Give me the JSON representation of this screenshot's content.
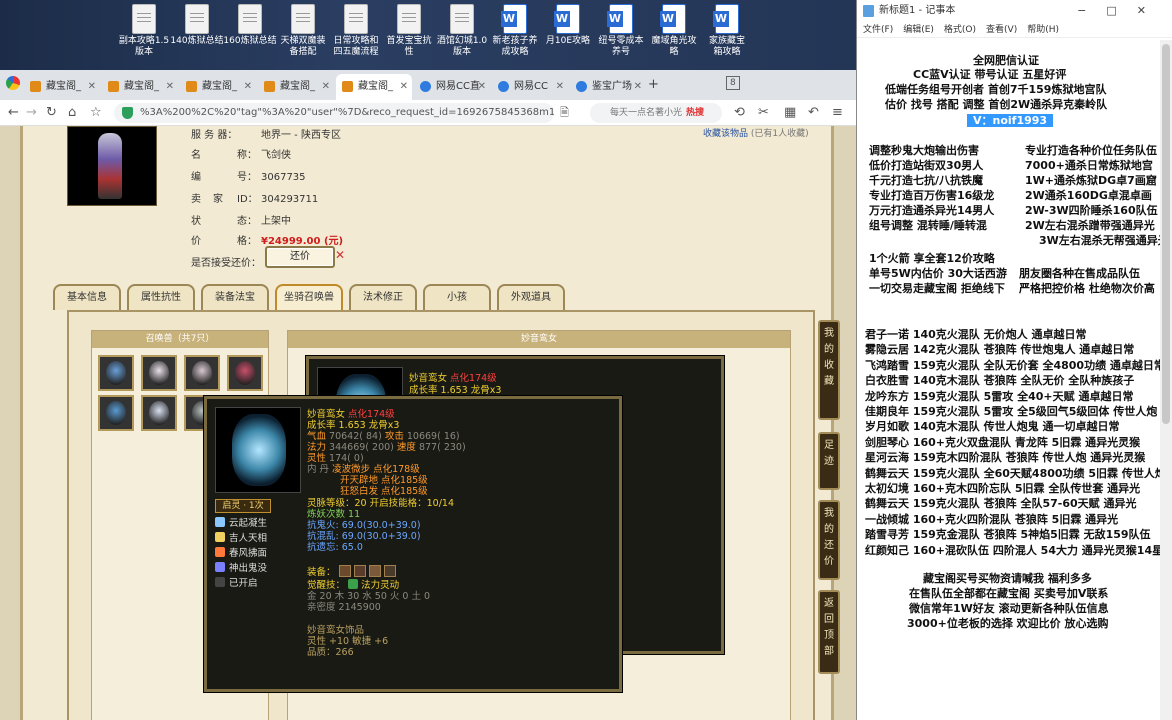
{
  "desktop": {
    "icons": [
      {
        "label": "副本攻略1.5\n版本",
        "type": "doc"
      },
      {
        "label": "140炼狱总结",
        "type": "doc"
      },
      {
        "label": "160炼狱总结",
        "type": "doc"
      },
      {
        "label": "天梯双魔装\n备搭配",
        "type": "doc"
      },
      {
        "label": "日常攻略和\n四五魔流程",
        "type": "doc"
      },
      {
        "label": "首发宝宝抗\n性",
        "type": "doc"
      },
      {
        "label": "酒馆幻城1.0\n版本",
        "type": "doc"
      },
      {
        "label": "新老孩子养\n成攻略",
        "type": "word"
      },
      {
        "label": "月10E攻略",
        "type": "word"
      },
      {
        "label": "纽号零成本\n养号",
        "type": "word"
      },
      {
        "label": "魔域角光攻\n略",
        "type": "word"
      },
      {
        "label": "家族藏宝\n箱攻略",
        "type": "word"
      }
    ]
  },
  "browser": {
    "tabs": [
      {
        "label": "藏宝阁_",
        "active": false,
        "icon": "cbg"
      },
      {
        "label": "藏宝阁_",
        "active": false,
        "icon": "cbg"
      },
      {
        "label": "藏宝阁_",
        "active": false,
        "icon": "cbg"
      },
      {
        "label": "藏宝阁_",
        "active": false,
        "icon": "cbg"
      },
      {
        "label": "藏宝阁_",
        "active": true,
        "icon": "cbg"
      },
      {
        "label": "网易CC直",
        "active": false,
        "icon": "cc"
      },
      {
        "label": "网易CC",
        "active": false,
        "icon": "cc"
      },
      {
        "label": "鉴宝广场",
        "active": false,
        "icon": "web"
      }
    ],
    "tab_count": "8",
    "url": "%3A%200%2C%20\"tag\"%3A%20\"user\"%7D&reco_request_id=1692675845368m12Ga",
    "search_placeholder": "每天一点名著小光",
    "search_badge": "热搜"
  },
  "listing": {
    "server_label": "服 务 器：",
    "server_value": "地界一 - 陕西专区",
    "name_label": "名",
    "name_label2": "称：",
    "name_value": "飞剑侠",
    "id_label": "编",
    "id_label2": "号：",
    "id_value": "3067735",
    "seller_label": "卖",
    "seller_label2": "家",
    "seller_label3": "ID：",
    "seller_value": "304293711",
    "status_label": "状",
    "status_label2": "态：",
    "status_value": "上架中",
    "price_label": "价",
    "price_label2": "格：",
    "price_value": "¥24999.00 (元)",
    "bargain_label": "是否接受还价：",
    "bargain_button": "还价",
    "favorite_link": "收藏该物品",
    "favorite_count": "(已有1人收藏)"
  },
  "tabs": [
    {
      "label": "基本信息",
      "active": false
    },
    {
      "label": "属性抗性",
      "active": false
    },
    {
      "label": "装备法宝",
      "active": false
    },
    {
      "label": "坐骑召唤兽",
      "active": true
    },
    {
      "label": "法术修正",
      "active": false
    },
    {
      "label": "小孩",
      "active": false
    },
    {
      "label": "外观道具",
      "active": false
    }
  ],
  "summon_panel": {
    "title": "召唤兽（共7只）",
    "pet_colors": [
      "#6aa0d8",
      "#e8e0e8",
      "#d8c8d0",
      "#c8506a",
      "#5a9ad0",
      "#d8e0f0",
      "#b8c0c0"
    ]
  },
  "detail_panel": {
    "title": "妙音鸾女"
  },
  "tooltip_back": {
    "name": "妙音鸾女",
    "tag": "点化174级",
    "growth": "成长率 1.653 龙骨x3"
  },
  "tooltip": {
    "name": "妙音鸾女",
    "tag": "点化174级",
    "growth": "成长率 1.653 龙骨x3",
    "qixue": "气血",
    "qixue_val": "70642( 84)",
    "gongji": "攻击",
    "gongji_val": "10669( 16)",
    "fali": "法力",
    "fali_val": "344669( 200)",
    "sudu": "速度",
    "sudu_val": "877( 230)",
    "lingxing": "灵性",
    "lingxing_val": "174( 0)",
    "neidan_label": "内  丹",
    "neidan1": "凌波微步 点化178级",
    "neidan2": "开天辟地 点化185级",
    "neidan3": "狂怒白发 点化185级",
    "spirit": "灵脉等级：20 开启技能格：10/14",
    "lianyao": "炼妖次数 11",
    "kanggui": "抗鬼火: 69.0(30.0+39.0)",
    "kanghun": "抗混乱: 69.0(30.0+39.0)",
    "kangyao": "抗遗忘: 65.0",
    "equip_label": "装备：",
    "awaken_label": "觉醒技：",
    "awaken_value": "法力灵动",
    "elements": "金 20 木 30 水 50 火 0 土 0",
    "qinmi": "亲密度 2145900",
    "ornament": "妙音鸾女饰品",
    "ornament_stat": "灵性 +10 敏捷 +6",
    "ornament_quality": "品质：266",
    "qiling_label": "启灵 · 1次",
    "skills": [
      {
        "name": "云起凝生",
        "color": "#8ac8ff"
      },
      {
        "name": "吉人天相",
        "color": "#f0d060"
      },
      {
        "name": "春风拂面",
        "color": "#ff7a3a"
      },
      {
        "name": "神出鬼没",
        "color": "#7a80ff"
      },
      {
        "name": "已开启",
        "color": "#444"
      }
    ]
  },
  "side_buttons": [
    {
      "label": "我的收藏"
    },
    {
      "label": "足迹"
    },
    {
      "label": "我的还价"
    },
    {
      "label": "返回顶部"
    }
  ],
  "notepad": {
    "title": "新标题1 - 记事本",
    "menu": [
      "文件(F)",
      "编辑(E)",
      "格式(O)",
      "查看(V)",
      "帮助(H)"
    ],
    "header_lines": [
      "全网肥信认证",
      "CC蓝V认证  带号认证 五星好评",
      "低端任务组号开创者        首创7千159炼狱地宫队",
      "估价 找号 搭配 调整        首创2W通杀异克秦岭队"
    ],
    "contact": "V：noif1993",
    "services": [
      [
        "调整秒鬼大炮输出伤害",
        "专业打造各种价位任务队伍"
      ],
      [
        "低价打造站街双30男人",
        "7000+通杀日常炼狱地宫"
      ],
      [
        "千元打造七抗/八抗铁魔",
        "1W+通杀炼狱DG卓7画窟"
      ],
      [
        "专业打造百万伤害16级龙",
        "2W通杀160DG卓混卓画"
      ],
      [
        "万元打造通杀异光14男人",
        "2W-3W四阶睡杀160队伍"
      ],
      [
        "组号调整 混转睡/睡转混",
        "2W左右混杀蹭带强通异光"
      ],
      [
        "",
        "3W左右混杀无帮强通异光"
      ]
    ],
    "promo": [
      [
        "1个火箭 享全套12价攻略",
        ""
      ],
      [
        "单号5W内估价 30大话西游",
        "朋友圈各种在售成品队伍"
      ],
      [
        "一切交易走藏宝阁 拒绝线下",
        "严格把控价格 杜绝物次价高"
      ]
    ],
    "teams": [
      "君子一诺 140克火混队 无价炮人 通卓越日常",
      "雾隐云居 142克火混队 苍狼阵 传世炮鬼人 通卓越日常",
      "飞鸿踏雪 159克火混队 全队无价套 全4800功绩 通卓越日常",
      "白衣胜雪 140克木混队 苍狼阵 全队无价 全队种族孩子",
      "龙吟东方 159克火混队 5雷攻 全40+天赋 通卓越日常",
      "佳期良年 159克火混队 5雷攻 全5级回气5级回体 传世人炮",
      "岁月如歌 140克木混队 传世人炮鬼 通一切卓越日常",
      "剑胆琴心 160+克火双盘混队 青龙阵 5旧霖 通异光灵猴",
      "星河云海 159克木四阶混队 苍狼阵 传世人炮 通异光灵猴",
      "鹤舞云天 159克火混队 全60天赋4800功绩 5旧霖 传世人炮",
      "太初幻境 160+克木四阶忘队 5旧霖 全队传世套 通异光",
      "鹤舞云天 159克火混队 苍狼阵 全队57-60天赋 通异光",
      "一战倾城 160+克火四阶混队 苍狼阵 5旧霖 通异光",
      "踏雪寻芳 159克金混队 苍狼阵 5神焰5旧霖 无敌159队伍",
      "红颜知己 160+混砍队伍 四阶混人 54大力 通异光灵猴14星"
    ],
    "footer": [
      "藏宝阁买号买物资请喊我 福利多多",
      "在售队伍全部都在藏宝阁 买卖号加V联系",
      "微信常年1W好友 滚动更新各种队伍信息",
      "3000+位老板的选择 欢迎比价 放心选购"
    ]
  }
}
